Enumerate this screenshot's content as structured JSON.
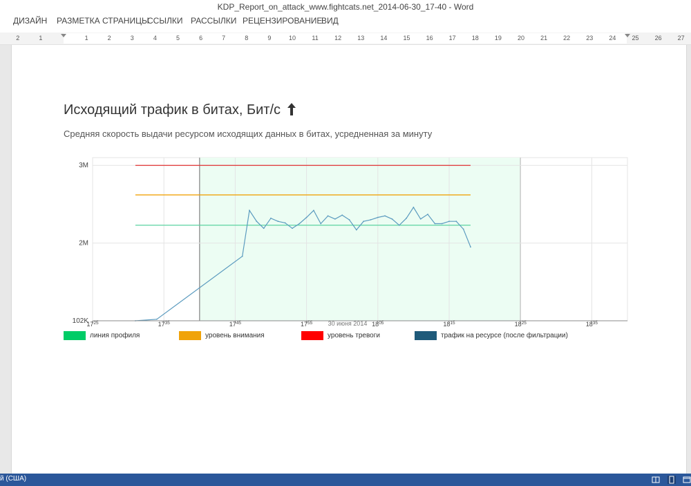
{
  "window": {
    "title": "KDP_Report_on_attack_www.fightcats.net_2014-06-30_17-40 - Word"
  },
  "menu": {
    "items": [
      "ДИЗАЙН",
      "РАЗМЕТКА СТРАНИЦЫ",
      "ССЫЛКИ",
      "РАССЫЛКИ",
      "РЕЦЕНЗИРОВАНИЕ",
      "ВИД"
    ]
  },
  "ruler": {
    "labels": [
      "2",
      "1",
      "1",
      "2",
      "3",
      "4",
      "5",
      "6",
      "7",
      "8",
      "9",
      "10",
      "11",
      "12",
      "13",
      "14",
      "15",
      "16",
      "17",
      "18",
      "19",
      "20",
      "21",
      "22",
      "23",
      "24",
      "25",
      "26",
      "27"
    ]
  },
  "document": {
    "heading": "Исходящий трафик в битах, Бит/с",
    "heading_icon": "arrow-up-icon",
    "subtitle": "Средняя скорость выдачи ресурсом исходящих данных в битах, усредненная за минуту"
  },
  "chart_data": {
    "type": "line",
    "title": "Исходящий трафик в битах, Бит/с",
    "subtitle": "Средняя скорость выдачи ресурсом исходящих данных в битах, усредненная за минуту",
    "xlabel": "30 июня 2014",
    "x_unit": "time (HH:MM)",
    "xlim": [
      "17:25",
      "18:40"
    ],
    "ylim": [
      1.0,
      3.1
    ],
    "y_unit": "M",
    "y_scale": "linear",
    "grid": true,
    "x_ticks": [
      {
        "h": "17",
        "m": "25"
      },
      {
        "h": "17",
        "m": "35"
      },
      {
        "h": "17",
        "m": "45"
      },
      {
        "h": "17",
        "m": "55"
      },
      {
        "h": "18",
        "m": "05"
      },
      {
        "h": "18",
        "m": "15"
      },
      {
        "h": "18",
        "m": "25"
      },
      {
        "h": "18",
        "m": "35"
      }
    ],
    "x_tick_minutes": [
      0,
      10,
      20,
      30,
      40,
      50,
      60,
      70
    ],
    "y_ticks": [
      {
        "label": "3M",
        "value": 3.0
      },
      {
        "label": "2M",
        "value": 2.0
      },
      {
        "label": "102K",
        "value": 1.0
      }
    ],
    "highlight_band": {
      "from": "17:40",
      "to": "18:25",
      "color": "#ecfdf3"
    },
    "series": [
      {
        "name": "линия профиля",
        "color": "#00cc66",
        "line_color": "#5ad3a0",
        "type": "horizontal",
        "value": 2.23,
        "x_range": [
          "17:31",
          "18:18"
        ]
      },
      {
        "name": "уровень внимания",
        "color": "#f0a30a",
        "line_color": "#f0a30a",
        "type": "horizontal",
        "value": 2.62,
        "x_range": [
          "17:31",
          "18:18"
        ]
      },
      {
        "name": "уровень тревоги",
        "color": "#ff0000",
        "line_color": "#e03030",
        "type": "horizontal",
        "value": 3.0,
        "x_range": [
          "17:31",
          "18:18"
        ]
      },
      {
        "name": "трафик на ресурсе (после фильтрации)",
        "color": "#1f5a7a",
        "line_color": "#5b9bbf",
        "type": "line",
        "x": [
          "17:31",
          "17:34",
          "17:46",
          "17:47",
          "17:48",
          "17:49",
          "17:50",
          "17:51",
          "17:52",
          "17:53",
          "17:54",
          "17:55",
          "17:56",
          "17:57",
          "17:58",
          "17:59",
          "18:00",
          "18:01",
          "18:02",
          "18:03",
          "18:04",
          "18:05",
          "18:06",
          "18:07",
          "18:08",
          "18:09",
          "18:10",
          "18:11",
          "18:12",
          "18:13",
          "18:14",
          "18:15",
          "18:16",
          "18:17",
          "18:18"
        ],
        "y": [
          1.0,
          1.02,
          1.83,
          2.42,
          2.28,
          2.19,
          2.32,
          2.28,
          2.26,
          2.19,
          2.25,
          2.33,
          2.42,
          2.25,
          2.35,
          2.31,
          2.36,
          2.3,
          2.17,
          2.28,
          2.3,
          2.33,
          2.35,
          2.31,
          2.23,
          2.32,
          2.46,
          2.31,
          2.37,
          2.25,
          2.25,
          2.28,
          2.28,
          2.18,
          1.95
        ]
      }
    ]
  },
  "legend": {
    "items": [
      {
        "label": "линия профиля",
        "color": "#00cc66"
      },
      {
        "label": "уровень внимания",
        "color": "#f0a30a"
      },
      {
        "label": "уровень тревоги",
        "color": "#ff0000"
      },
      {
        "label": "трафик на ресурсе (после фильтрации)",
        "color": "#1f5a7a"
      }
    ]
  },
  "statusbar": {
    "language": "й (США)",
    "bg": "#2b579a",
    "view_icons": [
      "read-mode-icon",
      "print-layout-icon",
      "web-layout-icon"
    ]
  }
}
